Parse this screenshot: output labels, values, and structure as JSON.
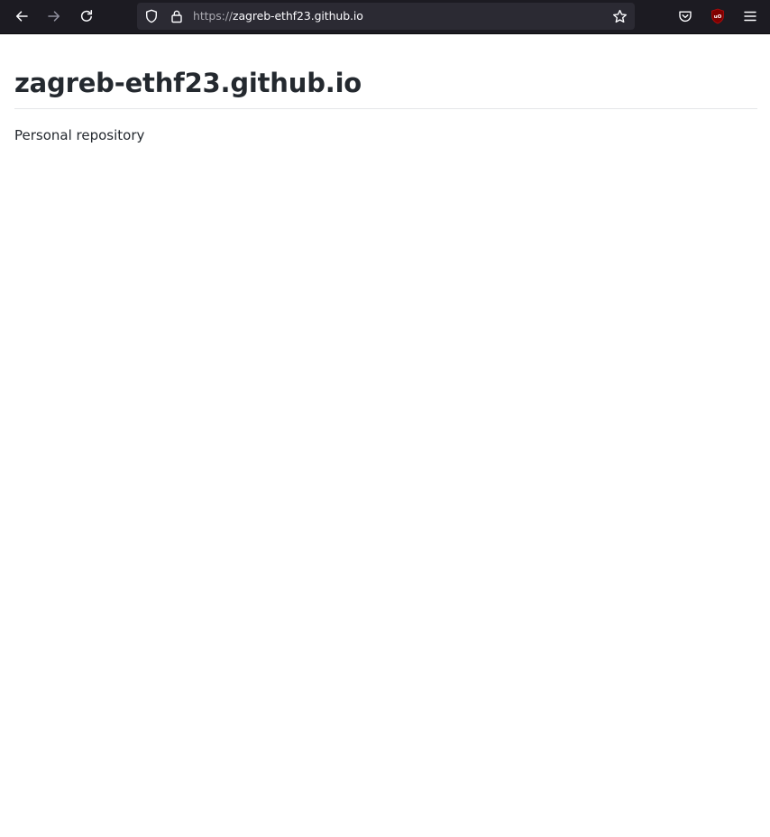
{
  "browser": {
    "url_scheme": "https://",
    "url_host": "zagreb-ethf23.github.io",
    "icons": {
      "back": "back-arrow-icon",
      "forward": "forward-arrow-icon",
      "reload": "reload-icon",
      "shield": "tracking-protection-shield-icon",
      "lock": "lock-icon",
      "bookmark": "star-icon",
      "pocket": "pocket-icon",
      "ublock": "ublock-origin-icon",
      "menu": "hamburger-menu-icon"
    },
    "ublock_badge_text": "uO",
    "colors": {
      "toolbar_bg": "#1c1b22",
      "urlbar_bg": "#2b2a33",
      "ublock_red": "#800000"
    }
  },
  "page": {
    "title": "zagreb-ethf23.github.io",
    "description": "Personal repository"
  }
}
